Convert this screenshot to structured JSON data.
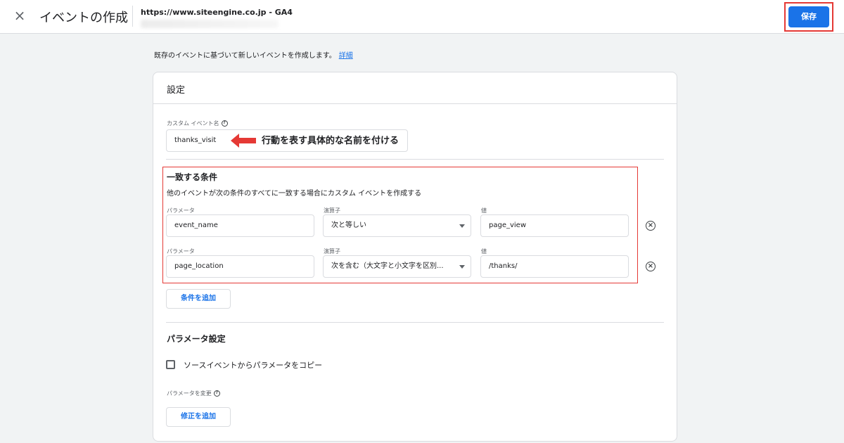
{
  "header": {
    "close_label": "×",
    "title": "イベントの作成",
    "property": "https://www.siteengine.co.jp - GA4",
    "save_label": "保存"
  },
  "intro": {
    "text": "既存のイベントに基づいて新しいイベントを作成します。",
    "link": "詳細"
  },
  "card": {
    "title": "設定",
    "custom_event": {
      "label": "カスタム イベント名",
      "value": "thanks_visit"
    },
    "annotation": "行動を表す具体的な名前を付ける",
    "matching": {
      "title": "一致する条件",
      "description": "他のイベントが次の条件のすべてに一致する場合にカスタム イベントを作成する",
      "conditions": [
        {
          "parameter_label": "パラメータ",
          "parameter": "event_name",
          "operator_label": "演算子",
          "operator": "次と等しい",
          "value_label": "値",
          "value": "page_view"
        },
        {
          "parameter_label": "パラメータ",
          "parameter": "page_location",
          "operator_label": "演算子",
          "operator": "次を含む（大文字と小文字を区別...",
          "value_label": "値",
          "value": "/thanks/"
        }
      ],
      "add_condition": "条件を追加"
    },
    "parameter_settings": {
      "title": "パラメータ設定",
      "copy_checkbox": "ソースイベントからパラメータをコピー",
      "copy_checked": false,
      "modify_label": "パラメータを変更",
      "add_modification": "修正を追加"
    }
  },
  "colors": {
    "accent": "#1a73e8",
    "highlight": "#e53935"
  }
}
